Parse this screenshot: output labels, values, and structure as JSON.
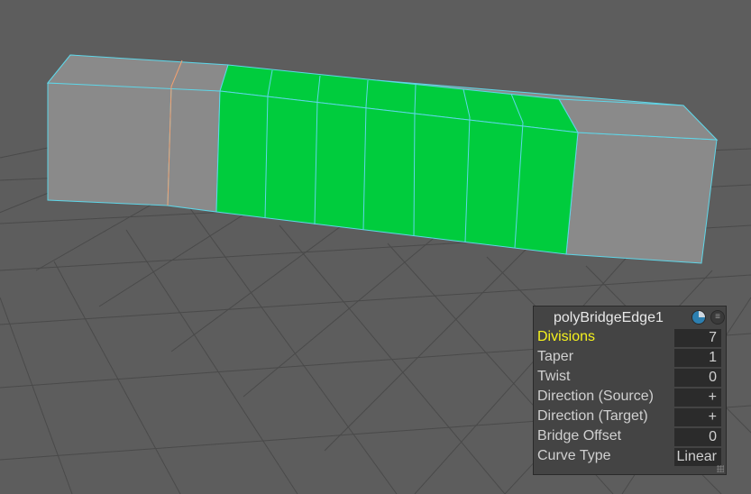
{
  "panel": {
    "title": "polyBridgeEdge1",
    "icons": [
      "node-pie-icon",
      "menu-icon"
    ],
    "rows": [
      {
        "label": "Divisions",
        "value": "7",
        "highlight": true
      },
      {
        "label": "Taper",
        "value": "1"
      },
      {
        "label": "Twist",
        "value": "0"
      },
      {
        "label": "Direction (Source)",
        "value": "+"
      },
      {
        "label": "Direction (Target)",
        "value": "+"
      },
      {
        "label": "Bridge Offset",
        "value": "0"
      },
      {
        "label": "Curve Type",
        "value": "Linear"
      }
    ]
  },
  "colors": {
    "background": "#5d5d5d",
    "grid": "#4a4a4a",
    "mesh_face": "#888888",
    "mesh_edge": "#5fd6e8",
    "selected_face": "#00cc3d",
    "highlight_label": "#f5f21e"
  }
}
